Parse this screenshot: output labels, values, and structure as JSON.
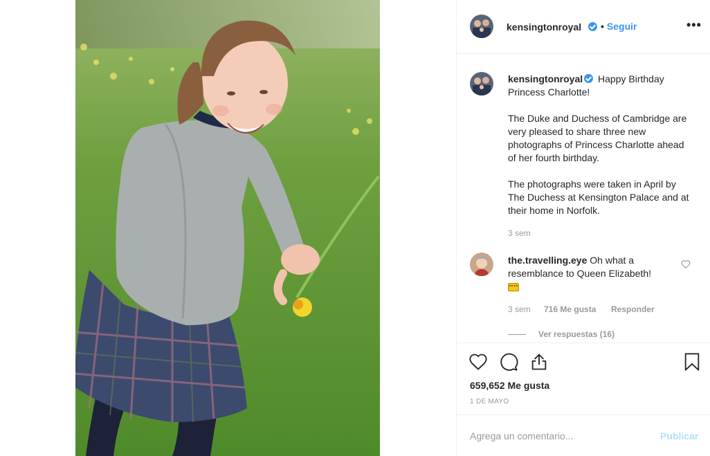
{
  "post": {
    "username": "kensingtonroyal",
    "follow_label": "Seguir",
    "follow_dot": "•",
    "more_label": "•••"
  },
  "caption": {
    "username": "kensingtonroyal",
    "line1": "Happy Birthday Princess Charlotte!",
    "paragraph2": "The Duke and Duchess of Cambridge are very pleased to share three new photographs of Princess Charlotte ahead of her fourth birthday.",
    "paragraph3": "The photographs were taken in April by The Duchess at Kensington Palace and at their home in Norfolk.",
    "time": "3 sem"
  },
  "comment": {
    "username": "the.travelling.eye",
    "text": "Oh what a resemblance to Queen Elizabeth!",
    "time": "3 sem",
    "likes": "716 Me gusta",
    "reply_label": "Responder",
    "view_replies": "Ver respuestas (16)"
  },
  "actions": {
    "likes": "659,652 Me gusta",
    "date": "1 DE MAYO"
  },
  "add_comment": {
    "placeholder": "Agrega un comentario...",
    "publish_label": "Publicar"
  },
  "colors": {
    "link_blue": "#3897f0",
    "publish_disabled": "#b2dffc",
    "meta_gray": "#999999"
  }
}
